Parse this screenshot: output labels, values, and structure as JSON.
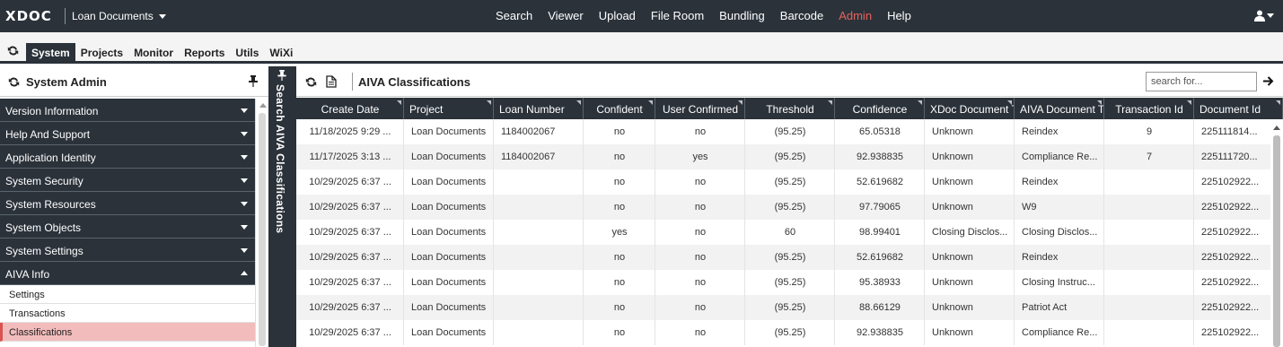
{
  "app": {
    "logo": "XDOC",
    "project": "Loan Documents"
  },
  "topnav": {
    "items": [
      "Search",
      "Viewer",
      "Upload",
      "File Room",
      "Bundling",
      "Barcode",
      "Admin",
      "Help"
    ],
    "active": "Admin",
    "active_color": "#e8625c"
  },
  "tabs": [
    "System",
    "Projects",
    "Monitor",
    "Reports",
    "Utils",
    "WiXi"
  ],
  "active_tab": "System",
  "sidebar": {
    "title": "System Admin",
    "sections": [
      {
        "label": "Version Information",
        "expanded": false
      },
      {
        "label": "Help And Support",
        "expanded": false
      },
      {
        "label": "Application Identity",
        "expanded": false
      },
      {
        "label": "System Security",
        "expanded": false
      },
      {
        "label": "System Resources",
        "expanded": false
      },
      {
        "label": "System Objects",
        "expanded": false
      },
      {
        "label": "System Settings",
        "expanded": false
      },
      {
        "label": "AIVA Info",
        "expanded": true
      }
    ],
    "subitems": [
      "Settings",
      "Transactions",
      "Classifications"
    ],
    "active_subitem": "Classifications",
    "collapsed_panel_label": "Search AIVA Classifications"
  },
  "main": {
    "title": "AIVA Classifications",
    "search_placeholder": "search for...",
    "columns": [
      "Create Date",
      "Project",
      "Loan Number",
      "Confident",
      "User Confirmed",
      "Threshold",
      "Confidence",
      "XDoc Document Ty",
      "AIVA Document Typ",
      "Transaction Id",
      "Document Id"
    ],
    "rows": [
      [
        "11/18/2025 9:29 ...",
        "Loan Documents",
        "1184002067",
        "no",
        "no",
        "(95.25)",
        "65.05318",
        "Unknown",
        "Reindex",
        "9",
        "225111814..."
      ],
      [
        "11/17/2025 3:13 ...",
        "Loan Documents",
        "1184002067",
        "no",
        "yes",
        "(95.25)",
        "92.938835",
        "Unknown",
        "Compliance Re...",
        "7",
        "225111720..."
      ],
      [
        "10/29/2025 6:37 ...",
        "Loan Documents",
        "",
        "no",
        "no",
        "(95.25)",
        "52.619682",
        "Unknown",
        "Reindex",
        "",
        "225102922..."
      ],
      [
        "10/29/2025 6:37 ...",
        "Loan Documents",
        "",
        "no",
        "no",
        "(95.25)",
        "97.79065",
        "Unknown",
        "W9",
        "",
        "225102922..."
      ],
      [
        "10/29/2025 6:37 ...",
        "Loan Documents",
        "",
        "yes",
        "no",
        "60",
        "98.99401",
        "Closing Disclos...",
        "Closing Disclos...",
        "",
        "225102922..."
      ],
      [
        "10/29/2025 6:37 ...",
        "Loan Documents",
        "",
        "no",
        "no",
        "(95.25)",
        "52.619682",
        "Unknown",
        "Reindex",
        "",
        "225102922..."
      ],
      [
        "10/29/2025 6:37 ...",
        "Loan Documents",
        "",
        "no",
        "no",
        "(95.25)",
        "95.38933",
        "Unknown",
        "Closing Instruc...",
        "",
        "225102922..."
      ],
      [
        "10/29/2025 6:37 ...",
        "Loan Documents",
        "",
        "no",
        "no",
        "(95.25)",
        "88.66129",
        "Unknown",
        "Patriot Act",
        "",
        "225102922..."
      ],
      [
        "10/29/2025 6:37 ...",
        "Loan Documents",
        "",
        "no",
        "no",
        "(95.25)",
        "92.938835",
        "Unknown",
        "Compliance Re...",
        "",
        "225102922..."
      ]
    ]
  },
  "icons": {
    "refresh": "refresh-icon",
    "pin": "pin-icon",
    "document": "document-icon",
    "arrow_right": "arrow-right-icon",
    "user": "user-icon"
  }
}
